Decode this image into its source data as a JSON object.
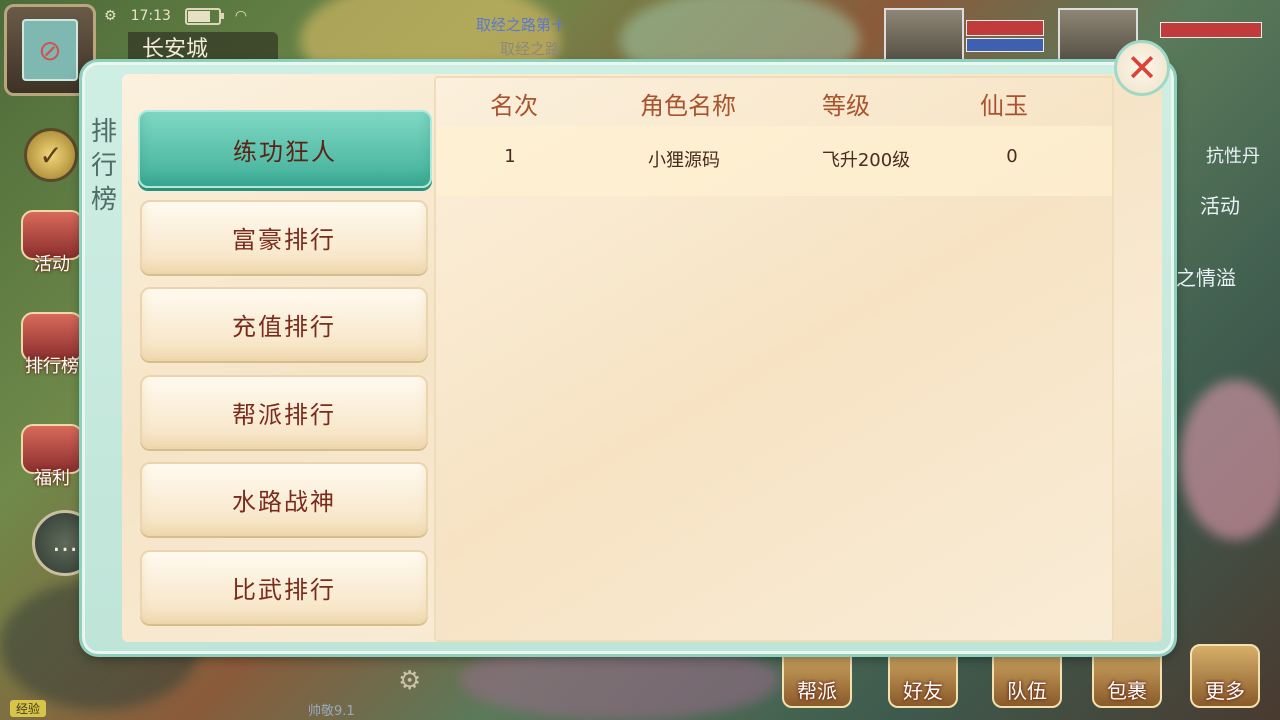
{
  "status": {
    "time": "17:13"
  },
  "hud": {
    "city_name": "长安城",
    "quest_title": "取经之路第十",
    "quest_sub": "取经之路",
    "right_texts": [
      "抗性丹",
      "活动",
      "之情溢"
    ],
    "side_icons": [
      "活动",
      "排行榜",
      "福利"
    ],
    "bottom_buttons": [
      "帮派",
      "好友",
      "队伍",
      "包裹",
      "更多"
    ],
    "exp_label": "经验",
    "bottom_text": "帅敬9.1"
  },
  "leaderboard": {
    "title": "排行榜",
    "categories": [
      "练功狂人",
      "富豪排行",
      "充值排行",
      "帮派排行",
      "水路战神",
      "比武排行"
    ],
    "active_index": 0,
    "columns": [
      "名次",
      "角色名称",
      "等级",
      "仙玉"
    ],
    "rows": [
      {
        "rank": "1",
        "name": "小狸源码",
        "level": "飞升200级",
        "jade": "0"
      }
    ]
  },
  "icons": {
    "close": "close-icon",
    "settings": "gear-icon",
    "chat": "chat-icon",
    "check": "check-icon",
    "map": "map-icon"
  }
}
